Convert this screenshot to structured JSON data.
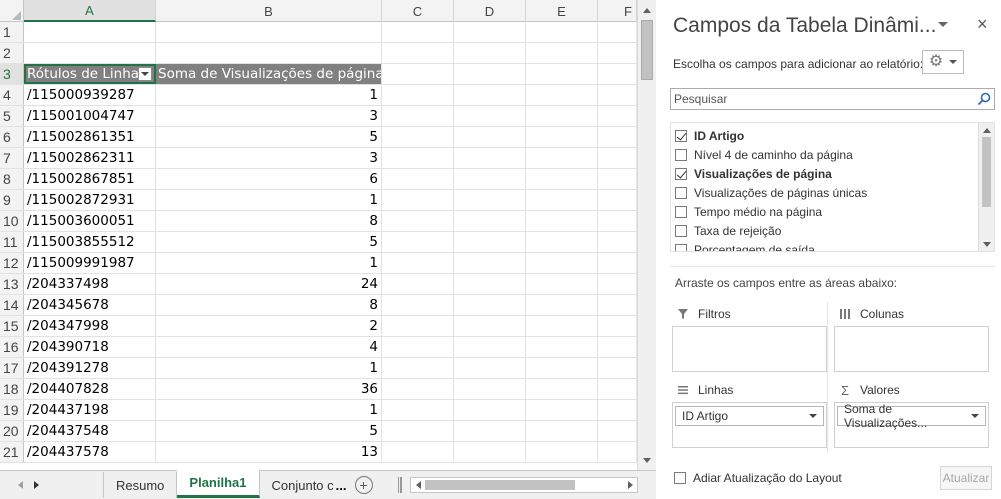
{
  "sheet": {
    "columns": [
      "A",
      "B",
      "C",
      "D",
      "E",
      "F"
    ],
    "selected_column": "A",
    "rows": [
      {
        "num": "1",
        "a": "",
        "b": ""
      },
      {
        "num": "2",
        "a": "",
        "b": ""
      },
      {
        "num": "3",
        "a": "Rótulos de Linha",
        "b": "Soma de Visualizações de página",
        "header": true
      },
      {
        "num": "4",
        "a": "/115000939287",
        "b": "1"
      },
      {
        "num": "5",
        "a": "/115001004747",
        "b": "3"
      },
      {
        "num": "6",
        "a": "/115002861351",
        "b": "5"
      },
      {
        "num": "7",
        "a": "/115002862311",
        "b": "3"
      },
      {
        "num": "8",
        "a": "/115002867851",
        "b": "6"
      },
      {
        "num": "9",
        "a": "/115002872931",
        "b": "1"
      },
      {
        "num": "10",
        "a": "/115003600051",
        "b": "8"
      },
      {
        "num": "11",
        "a": "/115003855512",
        "b": "5"
      },
      {
        "num": "12",
        "a": "/115009991987",
        "b": "1"
      },
      {
        "num": "13",
        "a": "/204337498",
        "b": "24"
      },
      {
        "num": "14",
        "a": "/204345678",
        "b": "8"
      },
      {
        "num": "15",
        "a": "/204347998",
        "b": "2"
      },
      {
        "num": "16",
        "a": "/204390718",
        "b": "4"
      },
      {
        "num": "17",
        "a": "/204391278",
        "b": "1"
      },
      {
        "num": "18",
        "a": "/204407828",
        "b": "36"
      },
      {
        "num": "19",
        "a": "/204437198",
        "b": "1"
      },
      {
        "num": "20",
        "a": "/204437548",
        "b": "5"
      },
      {
        "num": "21",
        "a": "/204437578",
        "b": "13"
      }
    ],
    "tabs": [
      "Resumo",
      "Planilha1",
      "Conjunto c"
    ],
    "active_tab": "Planilha1",
    "tab_ellipsis": "...",
    "add_sheet": "+"
  },
  "panel": {
    "title": "Campos da Tabela Dinâmi...",
    "close": "×",
    "choose_label": "Escolha os campos para adicionar ao relatório:",
    "search_placeholder": "Pesquisar",
    "fields": [
      {
        "label": "ID Artigo",
        "checked": true
      },
      {
        "label": "Nível 4 de caminho da página",
        "checked": false
      },
      {
        "label": "Visualizações de página",
        "checked": true
      },
      {
        "label": "Visualizações de páginas únicas",
        "checked": false
      },
      {
        "label": "Tempo médio na página",
        "checked": false
      },
      {
        "label": "Taxa de rejeição",
        "checked": false
      },
      {
        "label": "Porcentagem de saída",
        "checked": false
      }
    ],
    "drag_hint": "Arraste os campos entre as áreas abaixo:",
    "areas": {
      "filters": {
        "label": "Filtros",
        "value": ""
      },
      "columns": {
        "label": "Colunas",
        "value": ""
      },
      "rows": {
        "label": "Linhas",
        "value": "ID Artigo"
      },
      "values": {
        "label": "Valores",
        "value": "Soma de Visualizações..."
      }
    },
    "defer_label": "Adiar Atualização do Layout",
    "update_label": "Atualizar"
  },
  "icons": {
    "gear": "gear-icon",
    "search": "search-icon",
    "filter": "filter-icon",
    "columns": "columns-icon",
    "rows": "rows-icon",
    "sigma": "sigma-icon"
  },
  "colors": {
    "accent": "#217346",
    "pivot_header": "#808080"
  }
}
